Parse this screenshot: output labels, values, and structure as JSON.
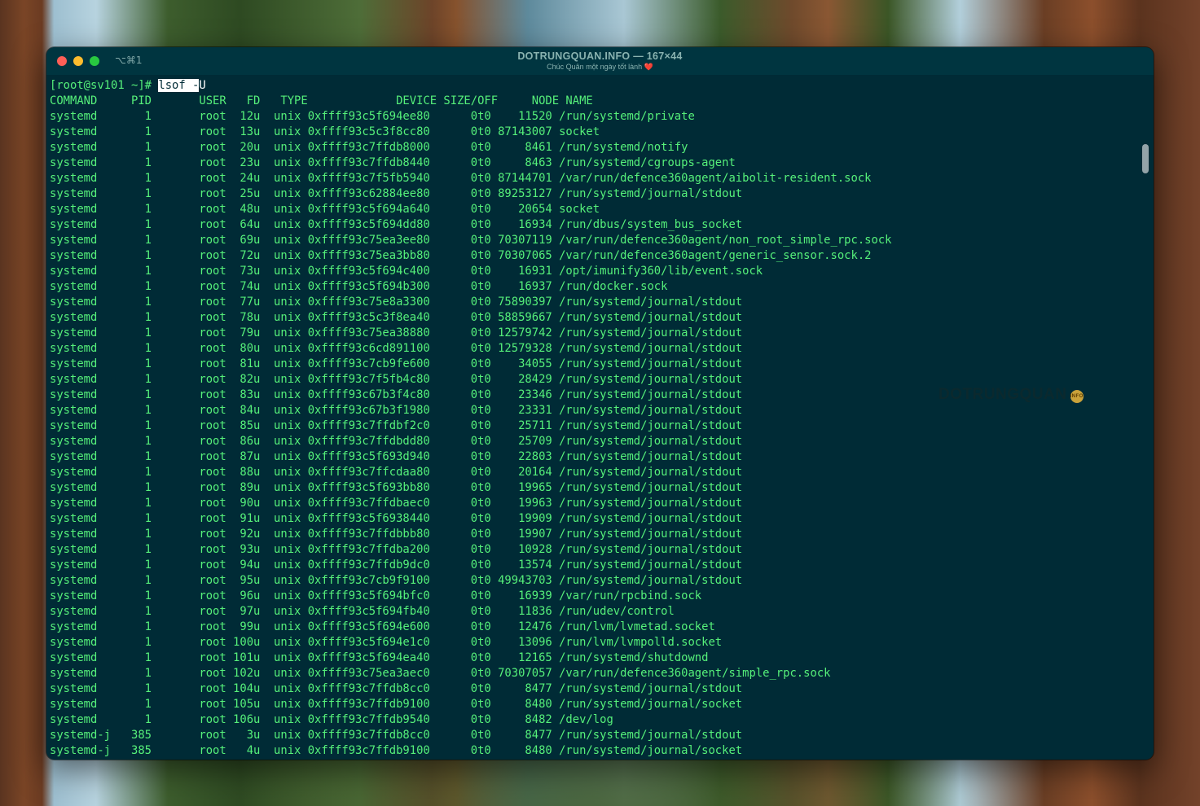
{
  "window": {
    "shortcut": "⌥⌘1",
    "title": "DOTRUNGQUAN.INFO — 167×44",
    "subtitle": "Chúc Quân một ngày tốt lành ❤️"
  },
  "watermark": {
    "text": "DOTRUNGQUAN",
    "badge": "INFO"
  },
  "prompt": {
    "text": "[root@sv101 ~]# ",
    "command": "lsof -",
    "cursor_char": "U"
  },
  "header": "COMMAND     PID       USER   FD   TYPE             DEVICE SIZE/OFF     NODE NAME",
  "rows": [
    "systemd       1       root  12u  unix 0xffff93c5f694ee80      0t0    11520 /run/systemd/private",
    "systemd       1       root  13u  unix 0xffff93c5c3f8cc80      0t0 87143007 socket",
    "systemd       1       root  20u  unix 0xffff93c7ffdb8000      0t0     8461 /run/systemd/notify",
    "systemd       1       root  23u  unix 0xffff93c7ffdb8440      0t0     8463 /run/systemd/cgroups-agent",
    "systemd       1       root  24u  unix 0xffff93c7f5fb5940      0t0 87144701 /var/run/defence360agent/aibolit-resident.sock",
    "systemd       1       root  25u  unix 0xffff93c62884ee80      0t0 89253127 /run/systemd/journal/stdout",
    "systemd       1       root  48u  unix 0xffff93c5f694a640      0t0    20654 socket",
    "systemd       1       root  64u  unix 0xffff93c5f694dd80      0t0    16934 /run/dbus/system_bus_socket",
    "systemd       1       root  69u  unix 0xffff93c75ea3ee80      0t0 70307119 /var/run/defence360agent/non_root_simple_rpc.sock",
    "systemd       1       root  72u  unix 0xffff93c75ea3bb80      0t0 70307065 /var/run/defence360agent/generic_sensor.sock.2",
    "systemd       1       root  73u  unix 0xffff93c5f694c400      0t0    16931 /opt/imunify360/lib/event.sock",
    "systemd       1       root  74u  unix 0xffff93c5f694b300      0t0    16937 /run/docker.sock",
    "systemd       1       root  77u  unix 0xffff93c75e8a3300      0t0 75890397 /run/systemd/journal/stdout",
    "systemd       1       root  78u  unix 0xffff93c5c3f8ea40      0t0 58859667 /run/systemd/journal/stdout",
    "systemd       1       root  79u  unix 0xffff93c75ea38880      0t0 12579742 /run/systemd/journal/stdout",
    "systemd       1       root  80u  unix 0xffff93c6cd891100      0t0 12579328 /run/systemd/journal/stdout",
    "systemd       1       root  81u  unix 0xffff93c7cb9fe600      0t0    34055 /run/systemd/journal/stdout",
    "systemd       1       root  82u  unix 0xffff93c7f5fb4c80      0t0    28429 /run/systemd/journal/stdout",
    "systemd       1       root  83u  unix 0xffff93c67b3f4c80      0t0    23346 /run/systemd/journal/stdout",
    "systemd       1       root  84u  unix 0xffff93c67b3f1980      0t0    23331 /run/systemd/journal/stdout",
    "systemd       1       root  85u  unix 0xffff93c7ffdbf2c0      0t0    25711 /run/systemd/journal/stdout",
    "systemd       1       root  86u  unix 0xffff93c7ffdbdd80      0t0    25709 /run/systemd/journal/stdout",
    "systemd       1       root  87u  unix 0xffff93c5f693d940      0t0    22803 /run/systemd/journal/stdout",
    "systemd       1       root  88u  unix 0xffff93c7ffcdaa80      0t0    20164 /run/systemd/journal/stdout",
    "systemd       1       root  89u  unix 0xffff93c5f693bb80      0t0    19965 /run/systemd/journal/stdout",
    "systemd       1       root  90u  unix 0xffff93c7ffdbaec0      0t0    19963 /run/systemd/journal/stdout",
    "systemd       1       root  91u  unix 0xffff93c5f6938440      0t0    19909 /run/systemd/journal/stdout",
    "systemd       1       root  92u  unix 0xffff93c7ffdbbb80      0t0    19907 /run/systemd/journal/stdout",
    "systemd       1       root  93u  unix 0xffff93c7ffdba200      0t0    10928 /run/systemd/journal/stdout",
    "systemd       1       root  94u  unix 0xffff93c7ffdb9dc0      0t0    13574 /run/systemd/journal/stdout",
    "systemd       1       root  95u  unix 0xffff93c7cb9f9100      0t0 49943703 /run/systemd/journal/stdout",
    "systemd       1       root  96u  unix 0xffff93c5f694bfc0      0t0    16939 /var/run/rpcbind.sock",
    "systemd       1       root  97u  unix 0xffff93c5f694fb40      0t0    11836 /run/udev/control",
    "systemd       1       root  99u  unix 0xffff93c5f694e600      0t0    12476 /run/lvm/lvmetad.socket",
    "systemd       1       root 100u  unix 0xffff93c5f694e1c0      0t0    13096 /run/lvm/lvmpolld.socket",
    "systemd       1       root 101u  unix 0xffff93c5f694ea40      0t0    12165 /run/systemd/shutdownd",
    "systemd       1       root 102u  unix 0xffff93c75ea3aec0      0t0 70307057 /var/run/defence360agent/simple_rpc.sock",
    "systemd       1       root 104u  unix 0xffff93c7ffdb8cc0      0t0     8477 /run/systemd/journal/stdout",
    "systemd       1       root 105u  unix 0xffff93c7ffdb9100      0t0     8480 /run/systemd/journal/socket",
    "systemd       1       root 106u  unix 0xffff93c7ffdb9540      0t0     8482 /dev/log",
    "systemd-j   385       root   3u  unix 0xffff93c7ffdb8cc0      0t0     8477 /run/systemd/journal/stdout",
    "systemd-j   385       root   4u  unix 0xffff93c7ffdb9100      0t0     8480 /run/systemd/journal/socket"
  ]
}
